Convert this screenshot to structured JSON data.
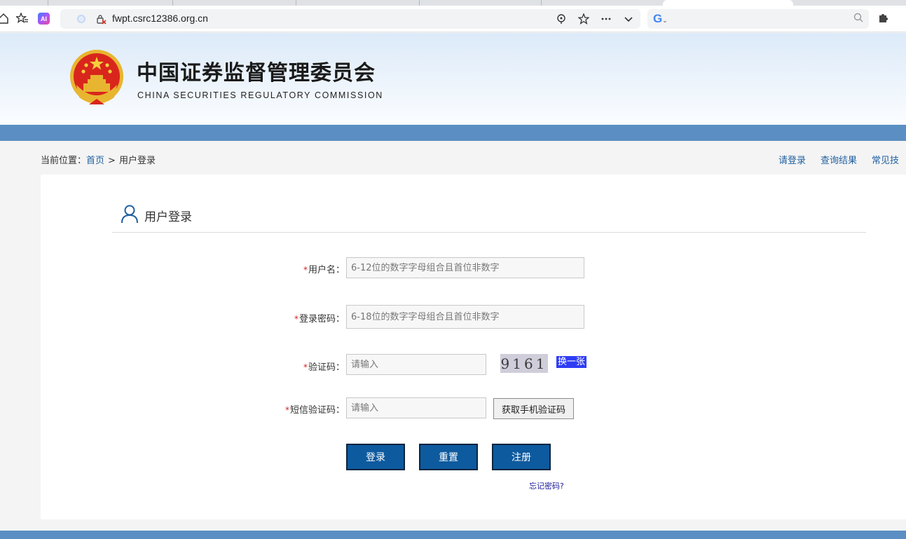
{
  "browser": {
    "url": "fwpt.csrc12386.org.cn",
    "ai_label": "AI",
    "search_logo": "G",
    "icons": [
      "home-icon",
      "favorites-star-list-icon",
      "ai-assistant-icon",
      "tracking-prevention-icon",
      "not-secure-icon",
      "read-aloud-icon",
      "favorite-star-icon",
      "more-dots-icon",
      "dropdown-chevron-icon",
      "search-magnifier-icon",
      "extensions-puzzle-icon"
    ]
  },
  "header": {
    "title_cn": "中国证券监督管理委员会",
    "title_en": "CHINA SECURITIES REGULATORY COMMISSION"
  },
  "breadcrumb": {
    "prefix": "当前位置：",
    "home": "首页",
    "separator": ">",
    "current": "用户登录"
  },
  "top_links": [
    "请登录",
    "查询结果",
    "常见技"
  ],
  "panel": {
    "title": "用户登录",
    "required_mark": "*",
    "fields": {
      "username": {
        "label": "用户名：",
        "placeholder": "6-12位的数字字母组合且首位非数字",
        "value": ""
      },
      "password": {
        "label": "登录密码：",
        "placeholder": "6-18位的数字字母组合且首位非数字",
        "value": ""
      },
      "captcha": {
        "label": "验证码：",
        "placeholder": "请输入",
        "value": ""
      },
      "sms": {
        "label": "短信验证码：",
        "placeholder": "请输入",
        "value": ""
      }
    },
    "captcha_text": "9161",
    "refresh_label": "换一张",
    "sms_button": "获取手机验证码",
    "buttons": {
      "login": "登录",
      "reset": "重置",
      "register": "注册"
    },
    "forgot": "忘记密码?"
  },
  "colors": {
    "band": "#5b8ec2",
    "button": "#0d5a9e",
    "link": "#1f5f9f",
    "required": "#d52020",
    "refresh_bg": "#2f3df5"
  }
}
